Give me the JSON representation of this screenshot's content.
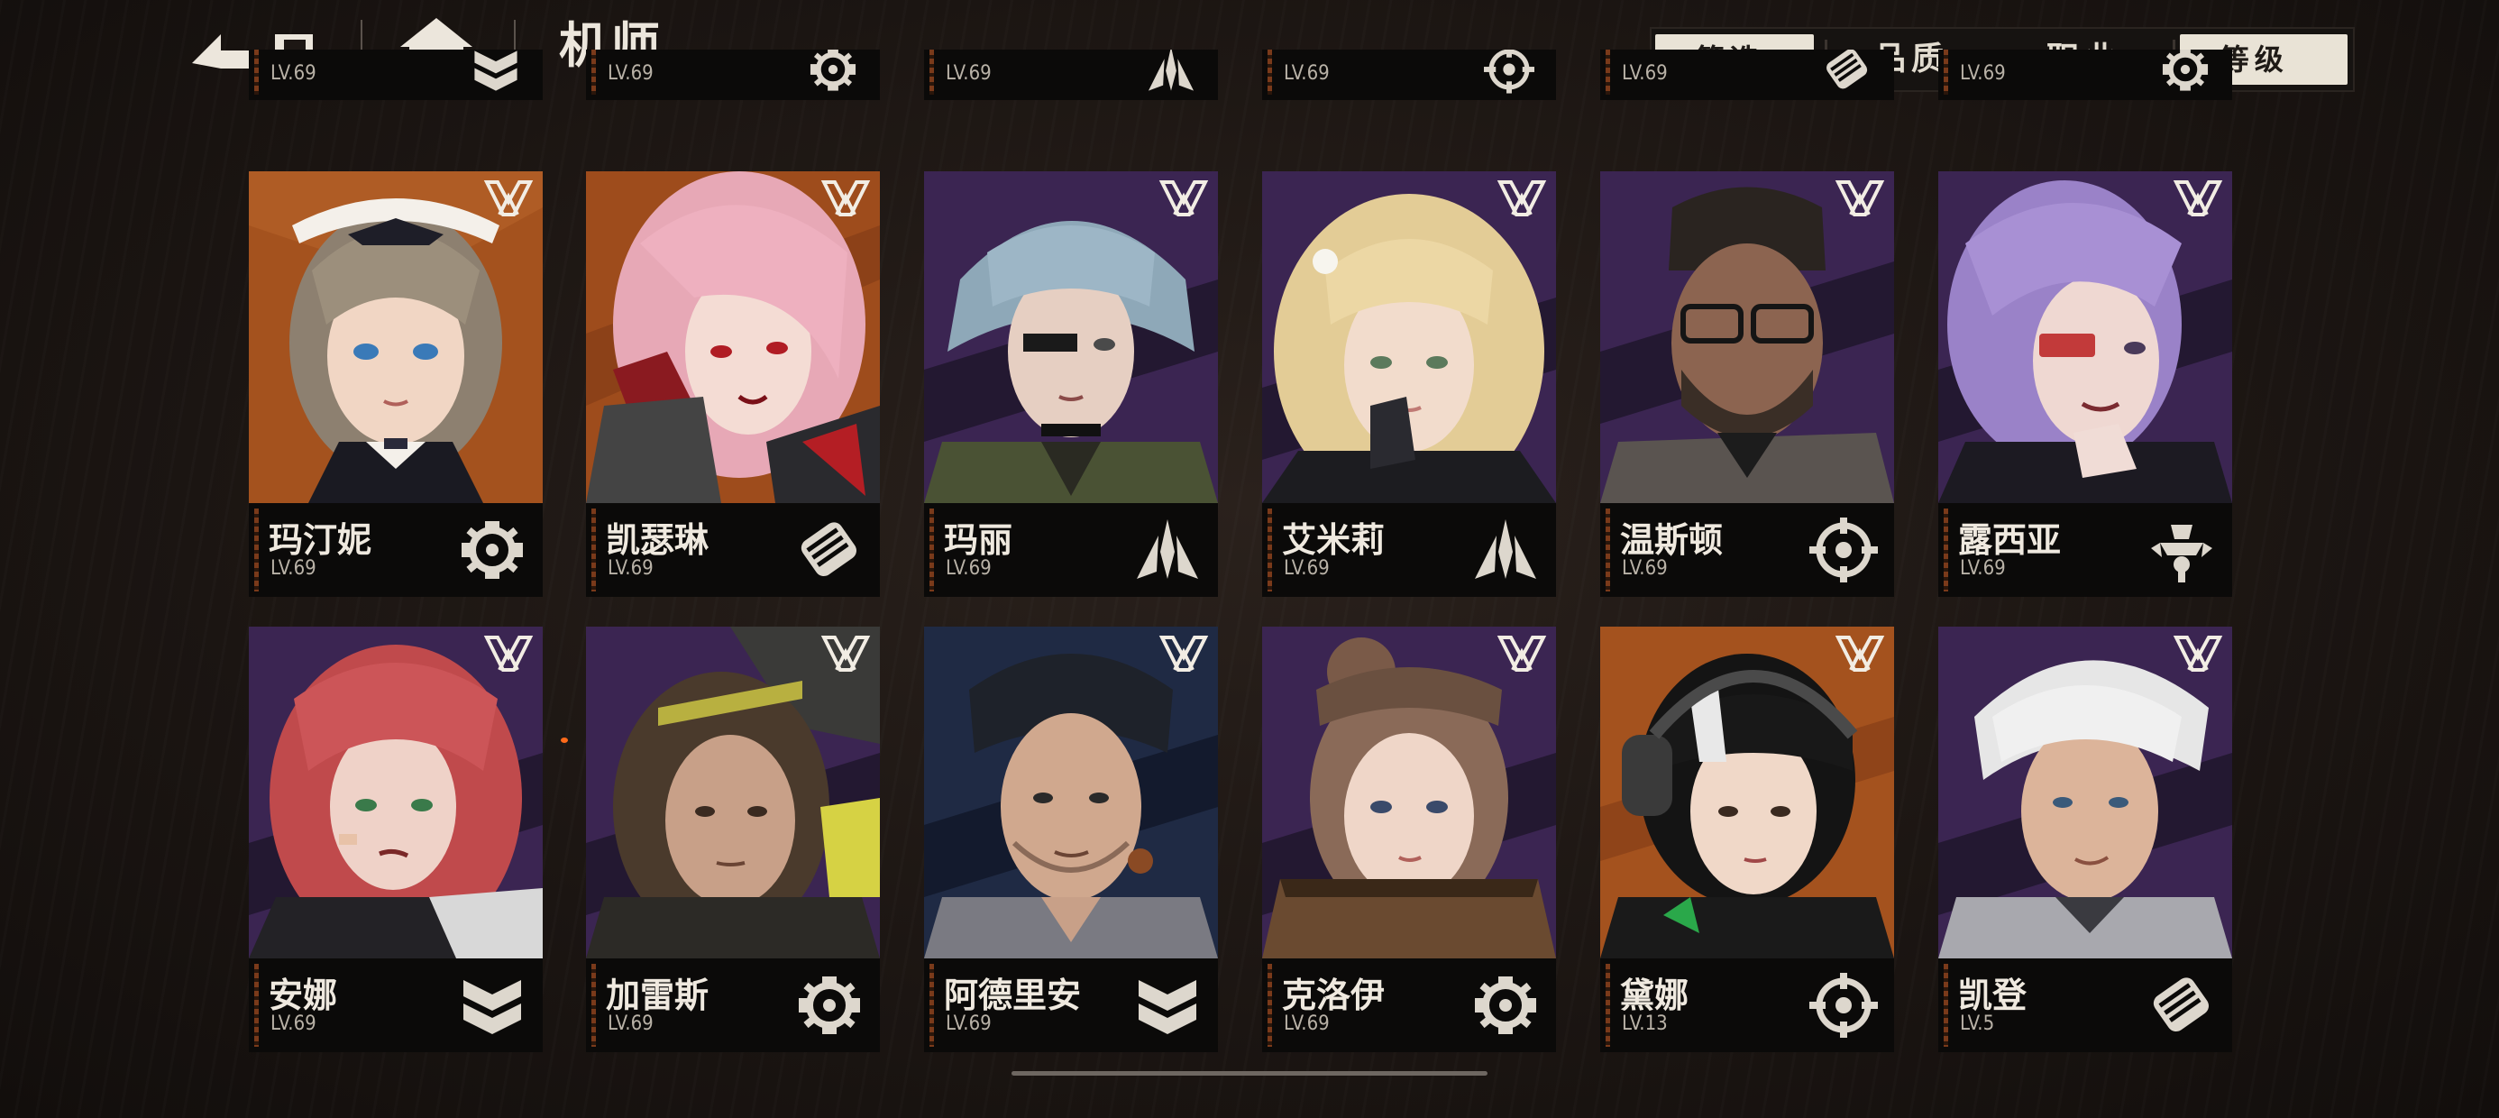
{
  "header": {
    "title": "机师",
    "back_icon": "back-arrow-icon",
    "home_icon": "home-icon"
  },
  "filters": {
    "filter_label": "筛选",
    "quality_label": "品质",
    "job_label": "职业",
    "level_label": "等级"
  },
  "colors": {
    "purple_bg": "#3b2552",
    "orange_bg": "#a4521e",
    "blue_bg": "#1f2a44",
    "pill": "#e9e3d6"
  },
  "top_partial_row": [
    {
      "level": "LV.69",
      "class_icon": "shield-chevron-icon"
    },
    {
      "level": "LV.69",
      "class_icon": "wrench-gear-icon"
    },
    {
      "level": "LV.69",
      "class_icon": "arrow-blade-icon"
    },
    {
      "level": "LV.69",
      "class_icon": "crosshair-icon"
    },
    {
      "level": "LV.69",
      "class_icon": "fist-icon"
    },
    {
      "level": "LV.69",
      "class_icon": "wrench-gear-icon"
    }
  ],
  "row1": [
    {
      "name": "玛汀妮",
      "level": "LV.69",
      "class_icon": "wrench-gear-icon",
      "bg": "orange"
    },
    {
      "name": "凯瑟琳",
      "level": "LV.69",
      "class_icon": "fist-icon",
      "bg": "orange"
    },
    {
      "name": "玛丽",
      "level": "LV.69",
      "class_icon": "arrow-blade-icon",
      "bg": "purple"
    },
    {
      "name": "艾米莉",
      "level": "LV.69",
      "class_icon": "arrow-blade-icon",
      "bg": "purple"
    },
    {
      "name": "温斯顿",
      "level": "LV.69",
      "class_icon": "crosshair-icon",
      "bg": "purple"
    },
    {
      "name": "露西亚",
      "level": "LV.69",
      "class_icon": "drone-icon",
      "bg": "purple"
    }
  ],
  "row2": [
    {
      "name": "安娜",
      "level": "LV.69",
      "class_icon": "shield-chevron-icon",
      "bg": "purple"
    },
    {
      "name": "加雷斯",
      "level": "LV.69",
      "class_icon": "wrench-gear-icon",
      "bg": "purple"
    },
    {
      "name": "阿德里安",
      "level": "LV.69",
      "class_icon": "shield-chevron-icon",
      "bg": "blue"
    },
    {
      "name": "克洛伊",
      "level": "LV.69",
      "class_icon": "wrench-gear-icon",
      "bg": "purple"
    },
    {
      "name": "黛娜",
      "level": "LV.13",
      "class_icon": "crosshair-icon",
      "bg": "orange"
    },
    {
      "name": "凯登",
      "level": "LV.5",
      "class_icon": "fist-icon",
      "bg": "purple"
    }
  ]
}
